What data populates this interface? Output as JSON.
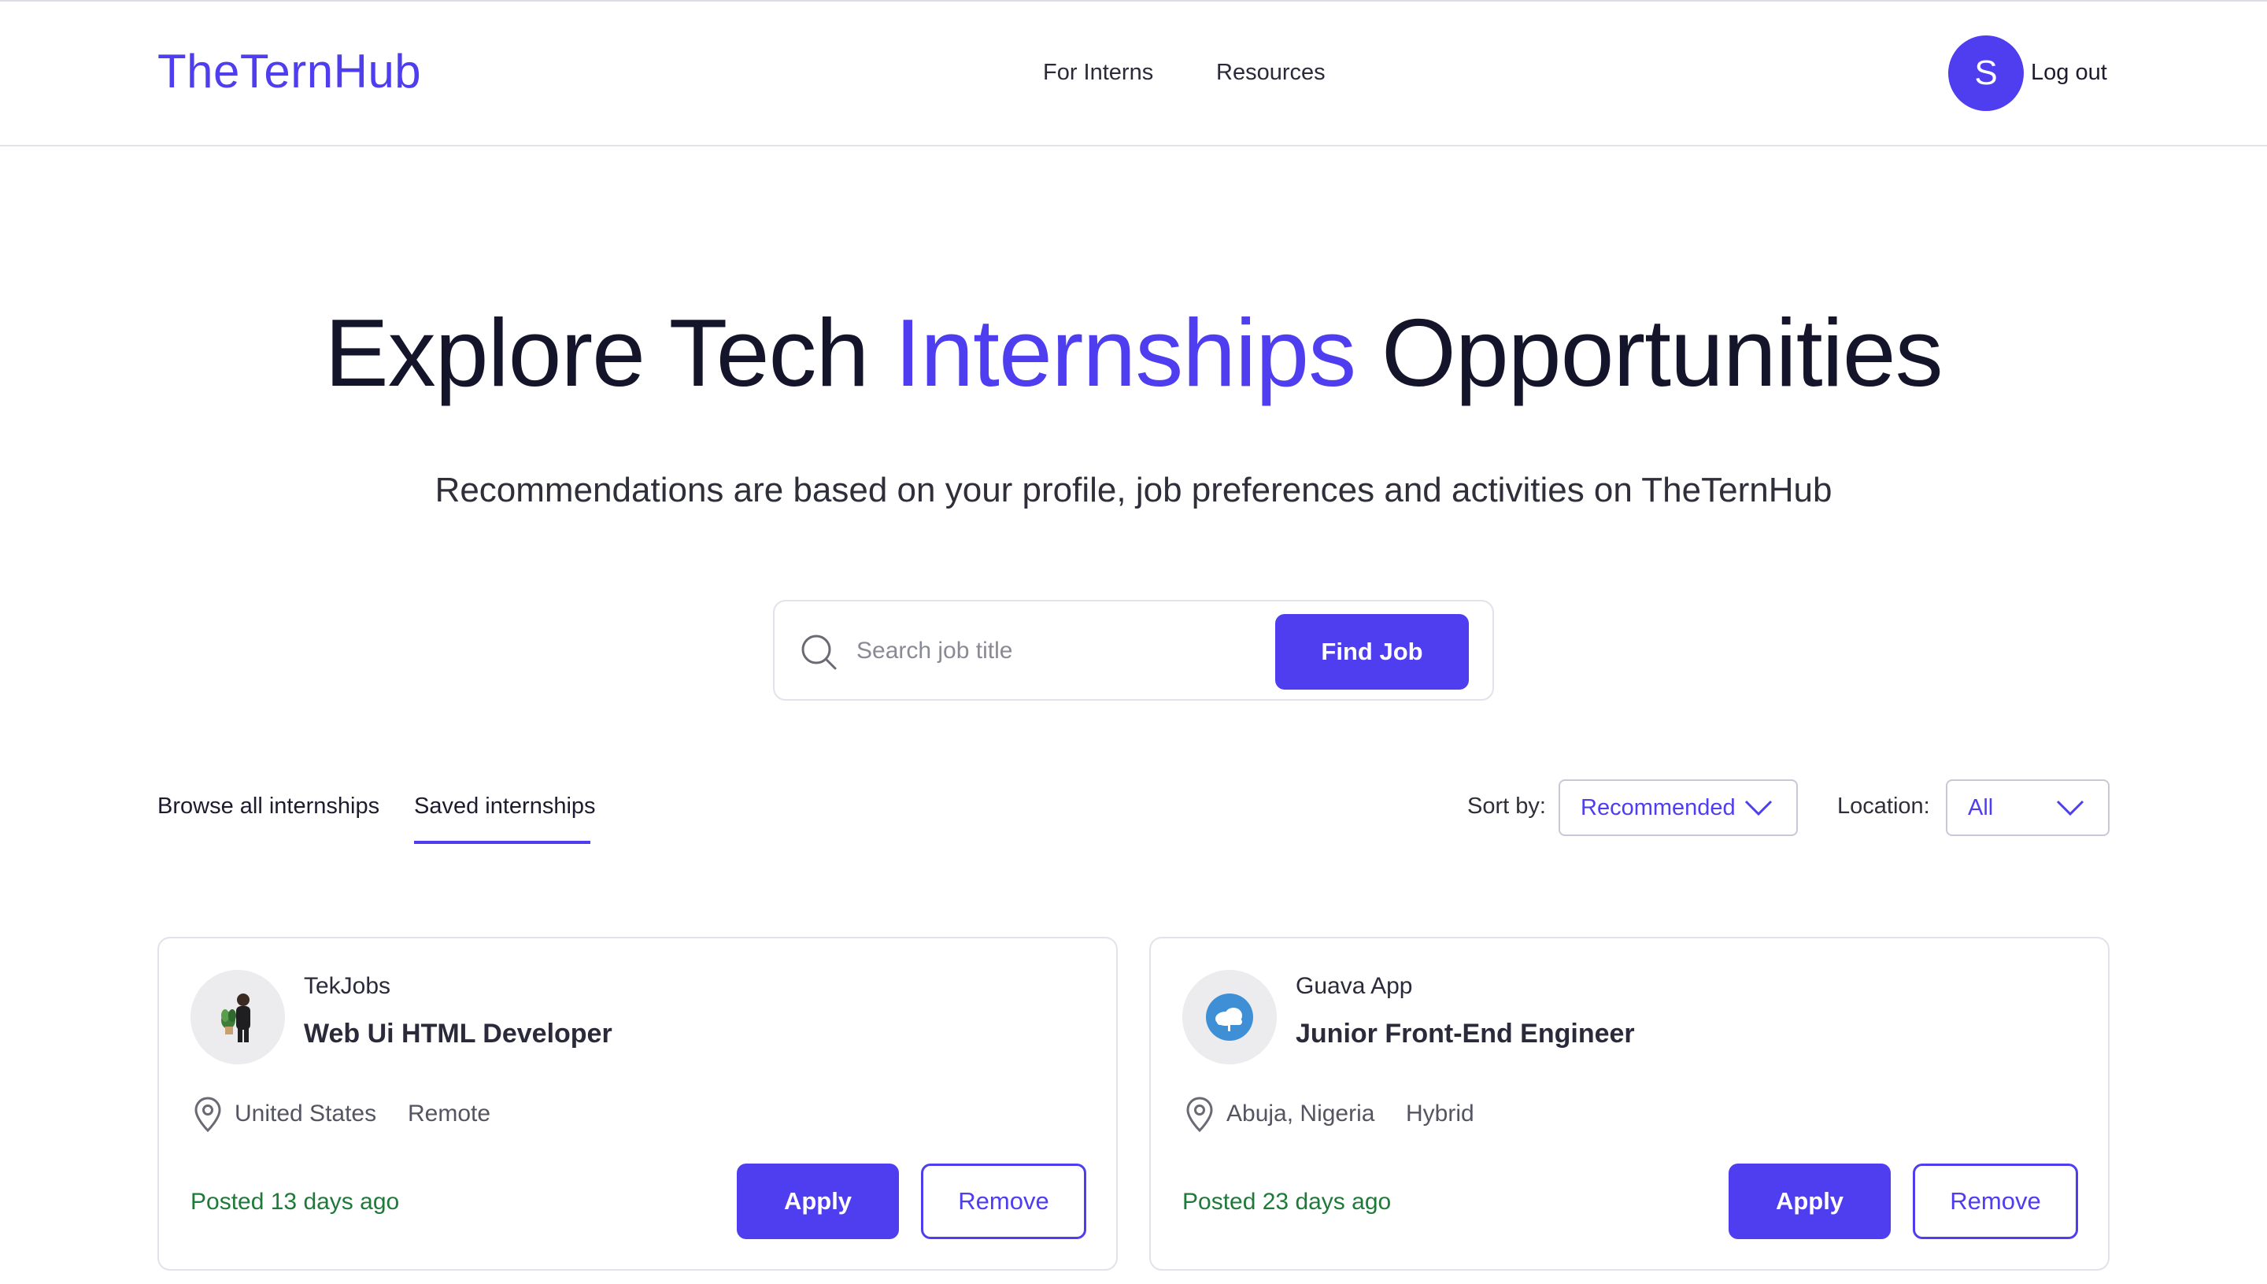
{
  "header": {
    "logo": "TheTernHub",
    "nav": [
      {
        "label": "For Interns"
      },
      {
        "label": "Resources"
      }
    ],
    "avatar_initial": "S",
    "logout_label": "Log out"
  },
  "hero": {
    "title_before": "Explore Tech",
    "title_accent": "Internships",
    "title_after": "Opportunities",
    "subtitle": "Recommendations are based on your profile, job preferences and activities on TheTernHub"
  },
  "search": {
    "placeholder": "Search job title",
    "value": "",
    "button_label": "Find Job"
  },
  "tabs": [
    {
      "label": "Browse all internships",
      "active": false
    },
    {
      "label": "Saved internships",
      "active": true
    }
  ],
  "filters": {
    "sort_label": "Sort by:",
    "sort_value": "Recommended",
    "location_label": "Location:",
    "location_value": "All"
  },
  "cards": [
    {
      "company": "TekJobs",
      "title": "Web Ui HTML Developer",
      "location": "United States",
      "mode": "Remote",
      "posted": "Posted 13 days ago",
      "apply_label": "Apply",
      "remove_label": "Remove"
    },
    {
      "company": "Guava App",
      "title": "Junior Front-End Engineer",
      "location": "Abuja, Nigeria",
      "mode": "Hybrid",
      "posted": "Posted 23 days ago",
      "apply_label": "Apply",
      "remove_label": "Remove"
    }
  ],
  "colors": {
    "brand": "#4f3df0",
    "posted_text": "#1f7a3a",
    "border": "#e2e2ea"
  },
  "icons": [
    "search-icon",
    "chevron-down-icon",
    "map-pin-icon",
    "company-logo-person",
    "company-logo-cloud"
  ]
}
